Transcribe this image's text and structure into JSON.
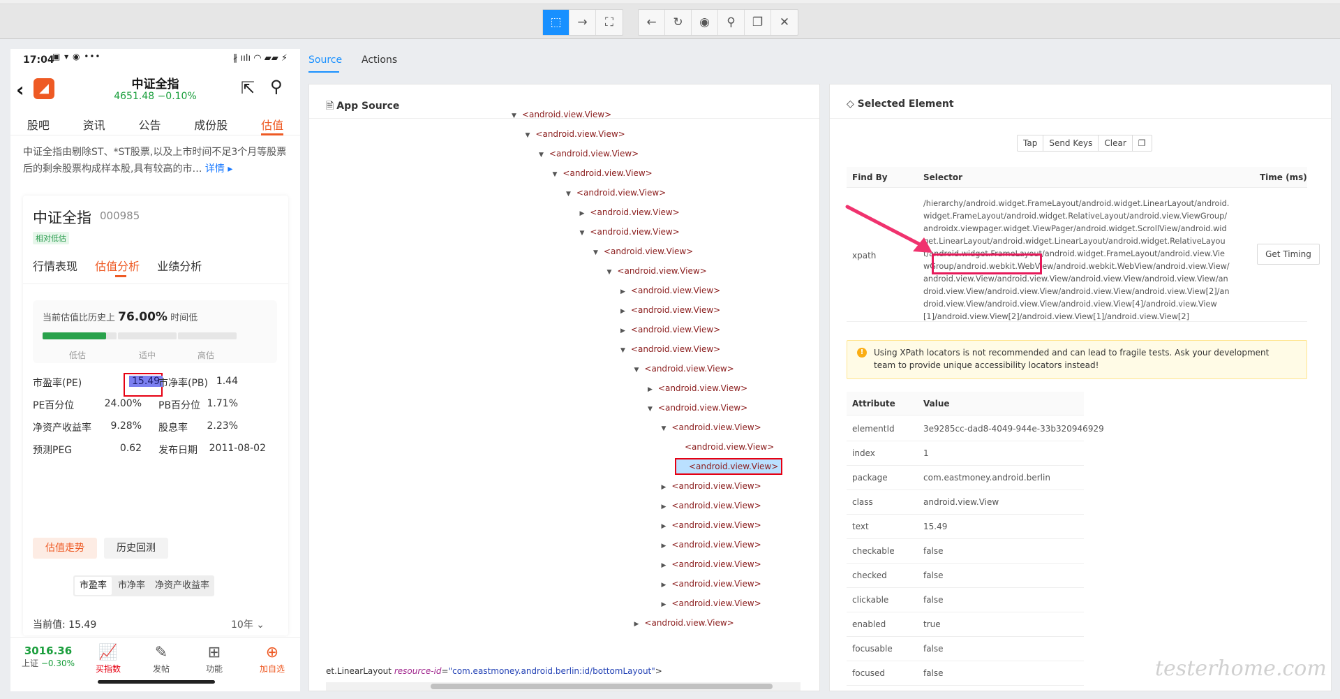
{
  "phone": {
    "status_time": "17:04",
    "status_icons": "▣ ▾ ◉ •••",
    "status_right": "∦ ıılı ◠ ▰▰ ⚡",
    "title": "中证全指",
    "price": "4651.48  −0.10%",
    "logo": "◢",
    "tabs": [
      "股吧",
      "资讯",
      "公告",
      "成份股",
      "估值"
    ],
    "desc_text": "中证全指由剔除ST、*ST股票,以及上市时间不足3个月等股票后的剩余股票构成样本股,具有较高的市…",
    "desc_more": "详情 ▸",
    "card": {
      "name": "中证全指",
      "code": "000985",
      "badge": "相对低估",
      "tabs": [
        "行情表现",
        "估值分析",
        "业绩分析"
      ],
      "gauge_prefix": "当前估值比历史上",
      "gauge_value": "76.00%",
      "gauge_suffix": "时间低",
      "gauge_fill_fraction": 0.86,
      "gauge_labels": [
        "低估",
        "适中",
        "高估"
      ],
      "metrics": [
        {
          "label": "市盈率(PE)",
          "value": "15.49",
          "label2": "市净率(PB)",
          "value2": "1.44"
        },
        {
          "label": "PE百分位",
          "value": "24.00%",
          "label2": "PB百分位",
          "value2": "1.71%"
        },
        {
          "label": "净资产收益率",
          "value": "9.28%",
          "label2": "股息率",
          "value2": "2.23%"
        },
        {
          "label": "预测PEG",
          "value": "0.62",
          "label2": "发布日期",
          "value2": "2011-08-02"
        }
      ],
      "btn_trend": "估值走势",
      "btn_backtest": "历史回测",
      "segments": [
        "市盈率",
        "市净率",
        "净资产收益率"
      ],
      "current_value": "当前值:  15.49",
      "period": "10年 ⌄"
    },
    "bottom": {
      "index_value": "3016.36",
      "index_name": "上证",
      "index_change": "−0.30%",
      "items": [
        {
          "icon": "📈",
          "label": "买指数"
        },
        {
          "icon": "✎",
          "label": "发帖"
        },
        {
          "icon": "⊞",
          "label": "功能"
        },
        {
          "icon": "⊕",
          "label": "加自选"
        }
      ]
    }
  },
  "toolbar": {
    "icons": [
      "⬚",
      "→",
      "⛶",
      "←",
      "↻",
      "◉",
      "⚲",
      "❐",
      "✕"
    ]
  },
  "main_tabs": [
    "Source",
    "Actions"
  ],
  "source": {
    "title": "App Source",
    "title_icon": "🗎",
    "nodes": [
      {
        "text": "<android.view.View>",
        "arrow": "▼",
        "depth": 0
      },
      {
        "text": "<android.view.View>",
        "arrow": "▼",
        "depth": 1
      },
      {
        "text": "<android.view.View>",
        "arrow": "▼",
        "depth": 2
      },
      {
        "text": "<android.view.View>",
        "arrow": "▼",
        "depth": 3
      },
      {
        "text": "<android.view.View>",
        "arrow": "▼",
        "depth": 4
      },
      {
        "text": "<android.view.View>",
        "arrow": "▶",
        "depth": 5
      },
      {
        "text": "<android.view.View>",
        "arrow": "▼",
        "depth": 5
      },
      {
        "text": "<android.view.View>",
        "arrow": "▼",
        "depth": 6
      },
      {
        "text": "<android.view.View>",
        "arrow": "▼",
        "depth": 7
      },
      {
        "text": "<android.view.View>",
        "arrow": "▶",
        "depth": 8
      },
      {
        "text": "<android.view.View>",
        "arrow": "▶",
        "depth": 8
      },
      {
        "text": "<android.view.View>",
        "arrow": "▶",
        "depth": 8
      },
      {
        "text": "<android.view.View>",
        "arrow": "▼",
        "depth": 8
      },
      {
        "text": "<android.view.View>",
        "arrow": "▼",
        "depth": 9
      },
      {
        "text": "<android.view.View>",
        "arrow": "▶",
        "depth": 10
      },
      {
        "text": "<android.view.View>",
        "arrow": "▼",
        "depth": 10
      },
      {
        "text": "<android.view.View>",
        "arrow": "▼",
        "depth": 11
      },
      {
        "text": "<android.view.View>",
        "arrow": "",
        "depth": 12
      },
      {
        "text": "<android.view.View>",
        "arrow": "",
        "depth": 12,
        "selected": true
      },
      {
        "text": "<android.view.View>",
        "arrow": "▶",
        "depth": 11
      },
      {
        "text": "<android.view.View>",
        "arrow": "▶",
        "depth": 11
      },
      {
        "text": "<android.view.View>",
        "arrow": "▶",
        "depth": 11
      },
      {
        "text": "<android.view.View>",
        "arrow": "▶",
        "depth": 11
      },
      {
        "text": "<android.view.View>",
        "arrow": "▶",
        "depth": 11
      },
      {
        "text": "<android.view.View>",
        "arrow": "▶",
        "depth": 11
      },
      {
        "text": "<android.view.View>",
        "arrow": "▶",
        "depth": 11
      },
      {
        "text": "<android.view.View>",
        "arrow": "▶",
        "depth": 9
      }
    ],
    "footer_prefix": "et.LinearLayout ",
    "footer_attr": "resource-id",
    "footer_eq": "=",
    "footer_value": "\"com.eastmoney.android.berlin:id/bottomLayout\"",
    "footer_suffix": ">"
  },
  "element": {
    "title": "Selected Element",
    "title_icon": "◇",
    "buttons": [
      "Tap",
      "Send Keys",
      "Clear",
      "❐"
    ],
    "find_by_header": "Find By",
    "selector_header": "Selector",
    "time_header": "Time (ms)",
    "find_by": "xpath",
    "selector": "/hierarchy/android.widget.FrameLayout/android.widget.LinearLayout/android.widget.FrameLayout/android.widget.RelativeLayout/android.view.ViewGroup/androidx.viewpager.widget.ViewPager/android.widget.ScrollView/android.widget.LinearLayout/android.widget.LinearLayout/android.widget.RelativeLayout/android.widget.FrameLayout/android.widget.FrameLayout/android.view.ViewGroup/android.webkit.WebView/android.webkit.WebView/android.view.View/android.view.View/android.view.View/android.view.View/android.view.View/android.view.View/android.view.View/android.view.View/android.view.View[2]/android.view.View/android.view.View/android.view.View[4]/android.view.View[1]/android.view.View[2]/android.view.View[1]/android.view.View[2]",
    "timing_button": "Get Timing",
    "warning": "Using XPath locators is not recommended and can lead to fragile tests. Ask your development team to provide unique accessibility locators instead!",
    "attr_header": "Attribute",
    "value_header": "Value",
    "attributes": [
      {
        "name": "elementId",
        "value": "3e9285cc-dad8-4049-944e-33b320946929"
      },
      {
        "name": "index",
        "value": "1"
      },
      {
        "name": "package",
        "value": "com.eastmoney.android.berlin"
      },
      {
        "name": "class",
        "value": "android.view.View"
      },
      {
        "name": "text",
        "value": "15.49"
      },
      {
        "name": "checkable",
        "value": "false"
      },
      {
        "name": "checked",
        "value": "false"
      },
      {
        "name": "clickable",
        "value": "false"
      },
      {
        "name": "enabled",
        "value": "true"
      },
      {
        "name": "focusable",
        "value": "false"
      },
      {
        "name": "focused",
        "value": "false"
      }
    ]
  },
  "watermark": "testerhome.com"
}
